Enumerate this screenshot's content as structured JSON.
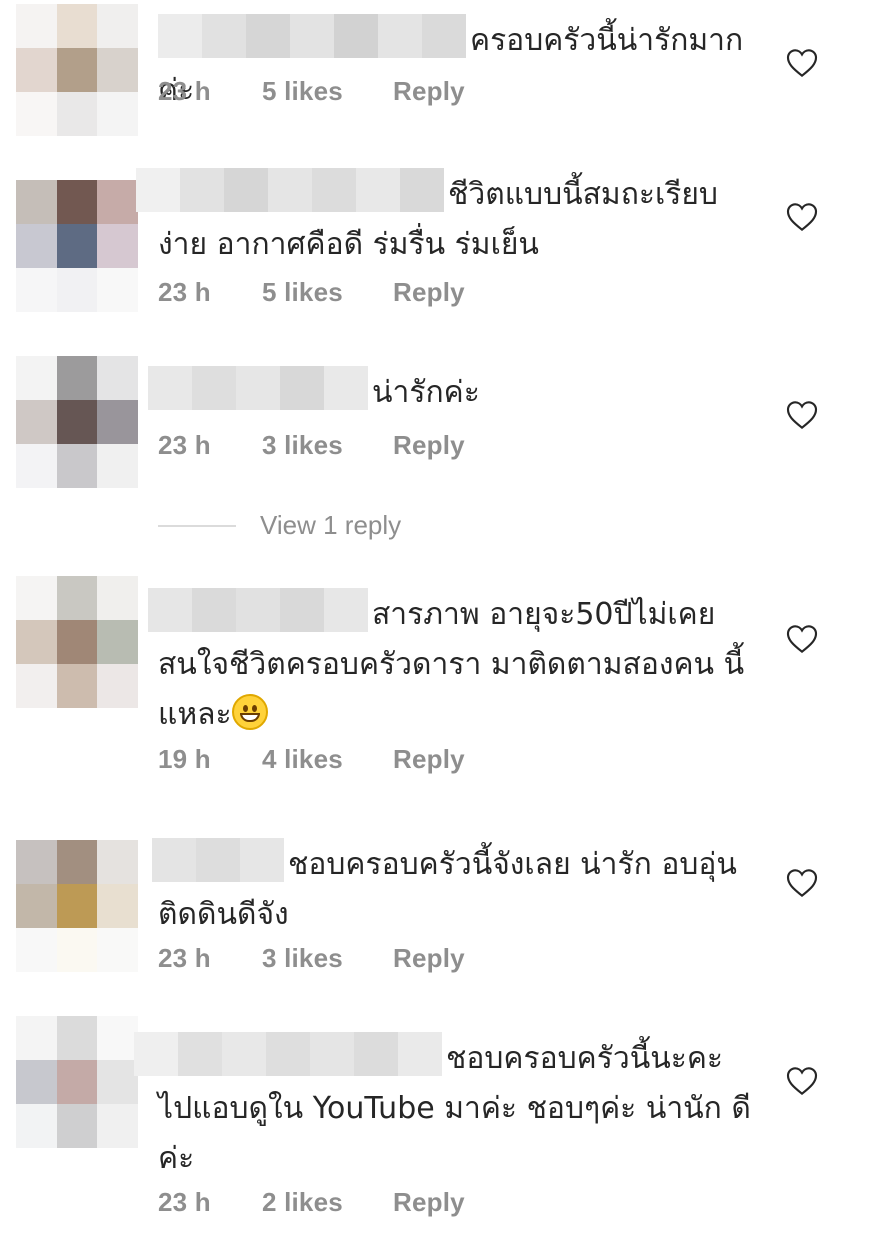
{
  "comments": [
    {
      "id": "c1",
      "text": "ครอบครัวนี้น่ารักมากค่ะ",
      "time": "23 h",
      "likes": "5 likes",
      "reply": "Reply",
      "avatar": [
        "#f5f3f2",
        "#e8ddd1",
        "#f0efee",
        "#e2d6cf",
        "#b29f8a",
        "#d8d2cc",
        "#f8f6f5",
        "#e9e8e8",
        "#f4f4f4"
      ],
      "name_blur": [
        "#ececec",
        "#e1e1e1",
        "#d6d6d6",
        "#e3e3e3",
        "#d2d2d2",
        "#e4e4e4",
        "#dadada"
      ]
    },
    {
      "id": "c2",
      "text": "ชีวิตแบบนี้สมถะเรียบ ง่าย อากาศคือดี ร่มรื่น ร่มเย็น",
      "time": "23 h",
      "likes": "5 likes",
      "reply": "Reply",
      "avatar": [
        "#c5beb8",
        "#725851",
        "#c6aba8",
        "#c8c8d1",
        "#5e6b83",
        "#d6c8d1",
        "#f6f6f7",
        "#f1f1f3",
        "#f8f8f8"
      ],
      "name_blur": [
        "#f0f0f0",
        "#e2e2e2",
        "#d6d6d6",
        "#e5e5e5",
        "#dcdcdc",
        "#e8e8e8",
        "#d9d9d9"
      ]
    },
    {
      "id": "c3",
      "text": "น่ารักค่ะ",
      "time": "23 h",
      "likes": "3 likes",
      "reply": "Reply",
      "avatar": [
        "#f3f3f3",
        "#9c9b9c",
        "#e4e4e5",
        "#cfc8c5",
        "#665654",
        "#99959b",
        "#f3f3f5",
        "#c9c8cb",
        "#f0f0f0"
      ],
      "name_blur": [
        "#e8e8e8",
        "#dedede",
        "#e6e6e6",
        "#d8d8d8",
        "#e9e9e9"
      ]
    },
    {
      "id": "c4",
      "text": "สารภาพ อายุจะ50ปีไม่เคย สนใจชีวิตครอบครัวดารา มาติดตามสองคน นี้แหละ",
      "time": "19 h",
      "likes": "4 likes",
      "reply": "Reply",
      "avatar": [
        "#f5f4f3",
        "#c9c8c2",
        "#f0efed",
        "#d4c7bb",
        "#a08776",
        "#b8bcb2",
        "#f2efee",
        "#cdbcae",
        "#ece7e6"
      ],
      "name_blur": [
        "#e6e6e6",
        "#dadada",
        "#e1e1e1",
        "#d9d9d9",
        "#e7e7e7"
      ]
    },
    {
      "id": "c5",
      "text": "ชอบครอบครัวนี้จังเลย น่ารัก อบอุ่น ติดดินดีจัง",
      "time": "23 h",
      "likes": "3 likes",
      "reply": "Reply",
      "avatar": [
        "#c6c1bf",
        "#a28f80",
        "#e5e2df",
        "#c2b7a9",
        "#bd9a55",
        "#e8dfd0",
        "#f8f8f8",
        "#fbf9f2",
        "#f9f9f8"
      ],
      "name_blur": [
        "#e4e4e4",
        "#dddddd",
        "#e6e6e6"
      ]
    },
    {
      "id": "c6",
      "text": "ชอบครอบครัวนี้นะคะ ไปแอบดูใน YouTube มาค่ะ ชอบๆค่ะ น่านัก ดีค่ะ",
      "time": "23 h",
      "likes": "2 likes",
      "reply": "Reply",
      "avatar": [
        "#f4f4f4",
        "#dbdbdb",
        "#f8f8f8",
        "#c7c8ce",
        "#c4aaa7",
        "#e4e4e4",
        "#f2f3f4",
        "#cfcfd0",
        "#f0f0f0"
      ],
      "name_blur": [
        "#efefef",
        "#e0e0e0",
        "#e8e8e8",
        "#dedede",
        "#e5e5e5",
        "#dcdcdc",
        "#eaeaea"
      ]
    }
  ],
  "view_replies": "View 1 reply",
  "icons": {
    "like": "heart-outline-icon",
    "emoji": "grinning-face-icon"
  },
  "colors": {
    "text": "#262626",
    "meta": "#8e8e8e",
    "divider": "#dbdbdb"
  }
}
